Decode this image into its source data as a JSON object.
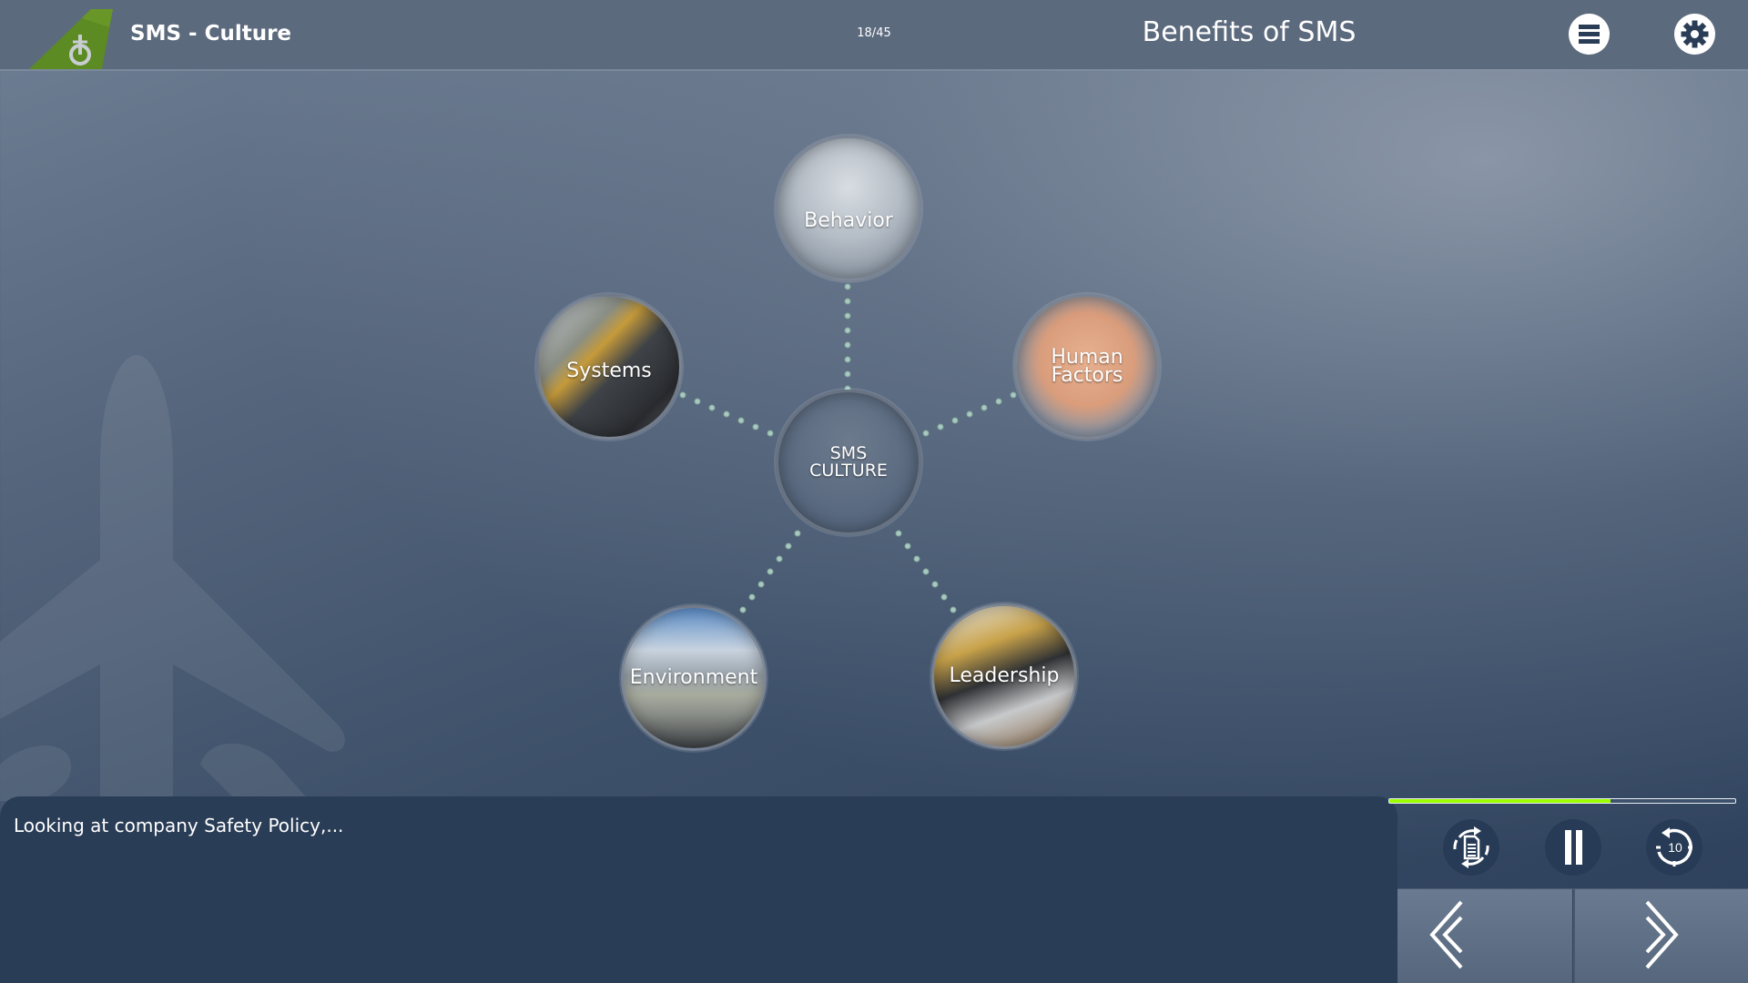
{
  "header": {
    "course_title": "SMS - Culture",
    "page_counter": "18/45",
    "page_title": "Benefits of SMS",
    "menu_icon": "hamburger-menu-icon",
    "settings_icon": "gear-icon",
    "logo_icon": "aircraft-tail-power-logo",
    "logo_color": "#5c8a23"
  },
  "diagram": {
    "center": {
      "line1": "SMS",
      "line2": "CULTURE"
    },
    "nodes": [
      {
        "id": "behavior",
        "line1": "Behavior",
        "line2": ""
      },
      {
        "id": "systems",
        "line1": "Systems",
        "line2": ""
      },
      {
        "id": "human-factors",
        "line1": "Human",
        "line2": "Factors"
      },
      {
        "id": "environment",
        "line1": "Environment",
        "line2": ""
      },
      {
        "id": "leadership",
        "line1": "Leadership",
        "line2": ""
      }
    ]
  },
  "caption": {
    "text": "Looking at company Safety Policy,..."
  },
  "player": {
    "progress_percent": 64,
    "progress_color": "#9cff00",
    "replay_icon": "replay-transcript-icon",
    "pause_icon": "pause-icon",
    "rewind_icon": "rewind-10-icon",
    "rewind_label": "10",
    "prev_icon": "double-chevron-left-icon",
    "next_icon": "chevron-right-icon"
  }
}
